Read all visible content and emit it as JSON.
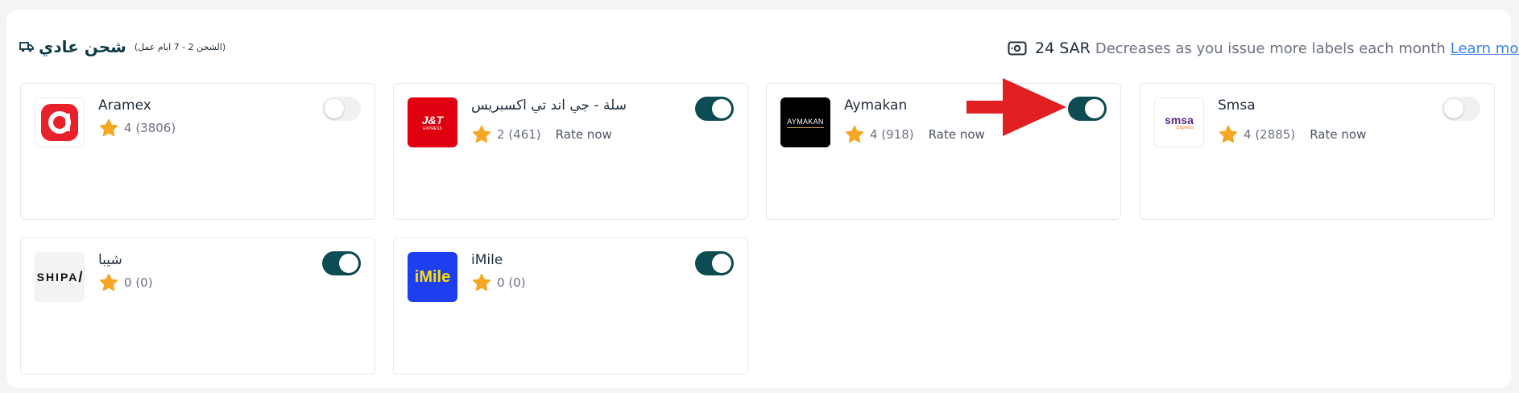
{
  "header": {
    "title": "شحن عادي",
    "subtitle": "(الشحن 2 - 7 ايام عمل)",
    "truck_icon": "truck-icon",
    "cash_icon": "cash-icon",
    "price": "24 SAR",
    "price_note": "Decreases as you issue more labels each month",
    "learn_more": "Learn more",
    "link_color": "#3b82f6"
  },
  "carriers": [
    {
      "name": "Aramex",
      "rating": "4",
      "count": "(3806)",
      "rate_now": "",
      "enabled": false,
      "logo": "aramex-logo"
    },
    {
      "name": "سلة - جي اند تي اكسبريس",
      "rating": "2",
      "count": "(461)",
      "rate_now": "Rate now",
      "enabled": true,
      "logo": "jt-express-logo",
      "logo_text": "J&T",
      "logo_sub": "EXPRESS"
    },
    {
      "name": "Aymakan",
      "rating": "4",
      "count": "(918)",
      "rate_now": "Rate now",
      "enabled": true,
      "logo": "aymakan-logo",
      "logo_text": "AYMAKAN"
    },
    {
      "name": "Smsa",
      "rating": "4",
      "count": "(2885)",
      "rate_now": "Rate now",
      "enabled": false,
      "logo": "smsa-logo",
      "logo_text": "smsa",
      "logo_sub": "Express"
    },
    {
      "name": "شيبا",
      "rating": "0",
      "count": "(0)",
      "rate_now": "",
      "enabled": true,
      "logo": "shipa-logo",
      "logo_text": "SHIPA"
    },
    {
      "name": "iMile",
      "rating": "0",
      "count": "(0)",
      "rate_now": "",
      "enabled": true,
      "logo": "imile-logo",
      "logo_text": "iMile"
    }
  ],
  "colors": {
    "toggle_on": "#0d4c52",
    "toggle_off": "#eef0f2",
    "star": "#f5a623",
    "annotation_arrow": "#e02020"
  }
}
